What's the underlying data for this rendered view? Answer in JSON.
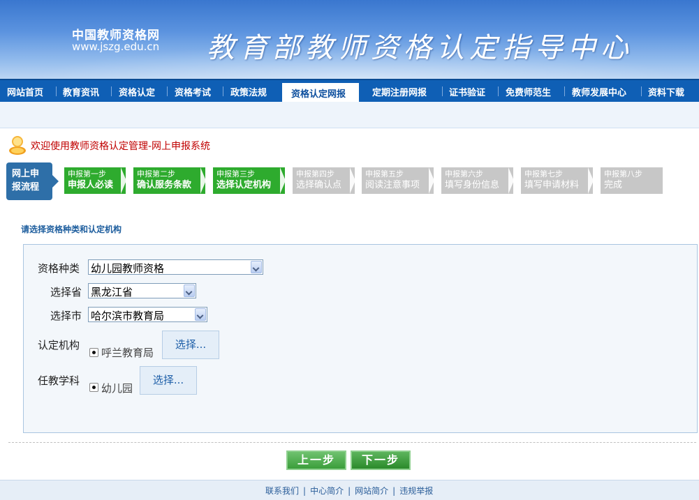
{
  "header": {
    "site_name": "中国教师资格网",
    "site_url": "www.jszg.edu.cn",
    "banner_title": "教育部教师资格认定指导中心"
  },
  "nav": {
    "items": [
      "网站首页",
      "教育资讯",
      "资格认定",
      "资格考试",
      "政策法规",
      "资格认定网报",
      "定期注册网报",
      "证书验证",
      "免费师范生",
      "教师发展中心",
      "资料下载"
    ],
    "active": "资格认定网报"
  },
  "welcome": {
    "icon": "user-icon",
    "text": "欢迎使用教师资格认定管理-网上申报系统"
  },
  "flow": {
    "label_line1": "网上申",
    "label_line2": "报流程",
    "steps": [
      {
        "step": "申报第一步",
        "name": "申报人必读",
        "status": "done"
      },
      {
        "step": "申报第二步",
        "name": "确认服务条款",
        "status": "done"
      },
      {
        "step": "申报第三步",
        "name": "选择认定机构",
        "status": "current"
      },
      {
        "step": "申报第四步",
        "name": "选择确认点",
        "status": "pending"
      },
      {
        "step": "申报第五步",
        "name": "阅读注意事项",
        "status": "pending"
      },
      {
        "step": "申报第六步",
        "name": "填写身份信息",
        "status": "pending"
      },
      {
        "step": "申报第七步",
        "name": "填写申请材料",
        "status": "pending"
      },
      {
        "step": "申报第八步",
        "name": "完成",
        "status": "pending"
      }
    ],
    "colors": {
      "active": "#2eab2e",
      "inactive": "#c7c7c7"
    }
  },
  "form": {
    "section_title": "请选择资格种类和认定机构",
    "qualification_label": "资格种类",
    "qualification_value": "幼儿园教师资格",
    "province_label": "选择省",
    "province_value": "黑龙江省",
    "city_label": "选择市",
    "city_value": "哈尔滨市教育局",
    "institution_label": "认定机构",
    "institution_value": "呼兰教育局",
    "institution_button": "选择...",
    "subject_label": "任教学科",
    "subject_value": "幼儿园",
    "subject_button": "选择..."
  },
  "actions": {
    "prev": "上一步",
    "next": "下一步"
  },
  "footer": {
    "links": [
      "联系我们",
      "中心简介",
      "网站简介",
      "违规举报"
    ]
  }
}
